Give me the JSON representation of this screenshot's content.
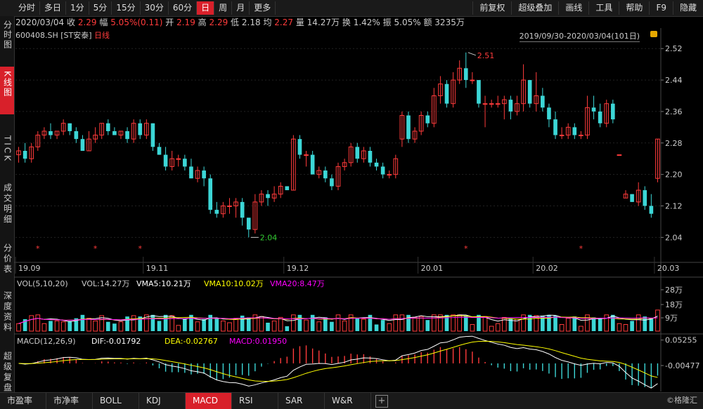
{
  "toolbar": {
    "periods": [
      "分时",
      "多日",
      "1分",
      "5分",
      "15分",
      "30分",
      "60分",
      "日",
      "周",
      "月",
      "更多"
    ],
    "active_period": "日",
    "right": [
      "前复权",
      "超级叠加",
      "画线",
      "工具",
      "帮助",
      "F9",
      "隐藏"
    ]
  },
  "sidebar": {
    "items": [
      "分时图",
      "K线图",
      "TICK",
      "成交明细",
      "分价表",
      "深度资料",
      "超级复盘"
    ],
    "active": "K线图"
  },
  "quote": {
    "date": "2020/03/04",
    "close_label": "收",
    "close": "2.29",
    "change_label": "幅",
    "change": "5.05%(0.11)",
    "open_label": "开",
    "open": "2.19",
    "high_label": "高",
    "high": "2.29",
    "low_label": "低",
    "low": "2.18",
    "avg_label": "均",
    "avg": "2.27",
    "volume_label": "量",
    "volume": "14.27万",
    "turnover_label": "换",
    "turnover": "1.42%",
    "amplitude_label": "振",
    "amplitude": "5.05%",
    "amount_label": "额",
    "amount": "3235万"
  },
  "symbol": "600408.SH",
  "name": "[ST安泰]",
  "line_type": "日线",
  "date_range": "2019/09/30-2020/03/04(101日)",
  "vol_legend": {
    "name": "VOL(5,10,20)",
    "vol": "VOL:14.27万",
    "vma5": "VMA5:10.21万",
    "vma10": "VMA10:10.02万",
    "vma20": "VMA20:8.47万"
  },
  "macd_legend": {
    "name": "MACD(12,26,9)",
    "dif": "DIF:-0.01792",
    "dea": "DEA:-0.02767",
    "macd": "MACD:0.01950"
  },
  "bottom_tabs": [
    "市盈率",
    "市净率",
    "BOLL",
    "KDJ",
    "MACD",
    "RSI",
    "SAR",
    "W&R"
  ],
  "active_bottom_tab": "MACD",
  "watermark": "©格隆汇",
  "colors": {
    "up": "#ff3b3b",
    "down": "#3cd6d6",
    "ma5": "#ffffff",
    "ma10": "#ffff00",
    "ma20": "#ff00ff",
    "accent": "#d8202a"
  },
  "chart_data": [
    {
      "type": "candlestick",
      "title": "600408.SH [ST安泰] 日线",
      "x_ticks": [
        "19.09",
        "19.11",
        "19.12",
        "20.01",
        "20.02",
        "20.03"
      ],
      "y_ticks": [
        2.52,
        2.44,
        2.36,
        2.28,
        2.2,
        2.12,
        2.04
      ],
      "ylim": [
        1.98,
        2.54
      ],
      "annotations": [
        {
          "label": "2.51",
          "value": 2.51
        },
        {
          "label": "2.04",
          "value": 2.04
        }
      ],
      "markers": "*",
      "candles": [
        [
          2.25,
          2.26,
          2.23,
          2.27
        ],
        [
          2.26,
          2.24,
          2.23,
          2.28
        ],
        [
          2.24,
          2.27,
          2.23,
          2.28
        ],
        [
          2.27,
          2.3,
          2.26,
          2.31
        ],
        [
          2.3,
          2.31,
          2.29,
          2.32
        ],
        [
          2.31,
          2.3,
          2.29,
          2.33
        ],
        [
          2.3,
          2.31,
          2.29,
          2.31
        ],
        [
          2.31,
          2.33,
          2.3,
          2.34
        ],
        [
          2.33,
          2.31,
          2.3,
          2.33
        ],
        [
          2.31,
          2.29,
          2.28,
          2.32
        ],
        [
          2.29,
          2.26,
          2.26,
          2.3
        ],
        [
          2.26,
          2.29,
          2.26,
          2.31
        ],
        [
          2.29,
          2.3,
          2.28,
          2.32
        ],
        [
          2.3,
          2.33,
          2.29,
          2.33
        ],
        [
          2.33,
          2.31,
          2.3,
          2.34
        ],
        [
          2.31,
          2.3,
          2.3,
          2.32
        ],
        [
          2.3,
          2.31,
          2.29,
          2.31
        ],
        [
          2.31,
          2.29,
          2.28,
          2.32
        ],
        [
          2.29,
          2.33,
          2.28,
          2.34
        ],
        [
          2.33,
          2.3,
          2.29,
          2.34
        ],
        [
          2.3,
          2.33,
          2.29,
          2.34
        ],
        [
          2.33,
          2.27,
          2.26,
          2.33
        ],
        [
          2.27,
          2.25,
          2.25,
          2.28
        ],
        [
          2.25,
          2.22,
          2.21,
          2.27
        ],
        [
          2.22,
          2.24,
          2.21,
          2.26
        ],
        [
          2.24,
          2.24,
          2.22,
          2.25
        ],
        [
          2.24,
          2.22,
          2.21,
          2.25
        ],
        [
          2.22,
          2.19,
          2.19,
          2.24
        ],
        [
          2.19,
          2.21,
          2.18,
          2.22
        ],
        [
          2.21,
          2.19,
          2.17,
          2.22
        ],
        [
          2.19,
          2.11,
          2.1,
          2.2
        ],
        [
          2.11,
          2.1,
          2.09,
          2.13
        ],
        [
          2.1,
          2.12,
          2.09,
          2.13
        ],
        [
          2.12,
          2.12,
          2.1,
          2.14
        ],
        [
          2.12,
          2.13,
          2.09,
          2.14
        ],
        [
          2.13,
          2.09,
          2.07,
          2.14
        ],
        [
          2.09,
          2.06,
          2.04,
          2.09
        ],
        [
          2.06,
          2.13,
          2.05,
          2.15
        ],
        [
          2.13,
          2.15,
          2.12,
          2.16
        ],
        [
          2.15,
          2.14,
          2.12,
          2.16
        ],
        [
          2.14,
          2.15,
          2.13,
          2.17
        ],
        [
          2.15,
          2.17,
          2.14,
          2.18
        ],
        [
          2.17,
          2.16,
          2.16,
          2.17
        ],
        [
          2.16,
          2.29,
          2.16,
          2.3
        ],
        [
          2.29,
          2.25,
          2.24,
          2.3
        ],
        [
          2.25,
          2.25,
          2.22,
          2.26
        ],
        [
          2.25,
          2.2,
          2.2,
          2.26
        ],
        [
          2.2,
          2.21,
          2.19,
          2.22
        ],
        [
          2.21,
          2.19,
          2.18,
          2.22
        ],
        [
          2.19,
          2.17,
          2.16,
          2.2
        ],
        [
          2.17,
          2.22,
          2.16,
          2.23
        ],
        [
          2.22,
          2.23,
          2.21,
          2.24
        ],
        [
          2.23,
          2.27,
          2.22,
          2.28
        ],
        [
          2.27,
          2.24,
          2.23,
          2.28
        ],
        [
          2.24,
          2.26,
          2.23,
          2.27
        ],
        [
          2.26,
          2.23,
          2.22,
          2.27
        ],
        [
          2.23,
          2.22,
          2.21,
          2.24
        ],
        [
          2.22,
          2.2,
          2.19,
          2.23
        ],
        [
          2.2,
          2.2,
          2.19,
          2.21
        ],
        [
          2.2,
          2.24,
          2.19,
          2.25
        ],
        [
          2.29,
          2.35,
          2.27,
          2.36
        ],
        [
          2.35,
          2.29,
          2.28,
          2.36
        ],
        [
          2.29,
          2.31,
          2.28,
          2.32
        ],
        [
          2.31,
          2.35,
          2.3,
          2.36
        ],
        [
          2.35,
          2.33,
          2.32,
          2.36
        ],
        [
          2.33,
          2.4,
          2.32,
          2.42
        ],
        [
          2.4,
          2.43,
          2.38,
          2.45
        ],
        [
          2.43,
          2.38,
          2.37,
          2.44
        ],
        [
          2.38,
          2.44,
          2.37,
          2.46
        ],
        [
          2.44,
          2.47,
          2.43,
          2.49
        ],
        [
          2.47,
          2.44,
          2.42,
          2.51
        ],
        [
          2.44,
          2.44,
          2.43,
          2.46
        ],
        [
          2.44,
          2.38,
          2.37,
          2.43
        ],
        [
          2.38,
          2.38,
          2.32,
          2.4
        ],
        [
          2.38,
          2.38,
          2.37,
          2.39
        ],
        [
          2.38,
          2.38,
          2.37,
          2.4
        ],
        [
          2.38,
          2.39,
          2.34,
          2.4
        ],
        [
          2.39,
          2.36,
          2.34,
          2.4
        ],
        [
          2.36,
          2.38,
          2.35,
          2.4
        ],
        [
          2.38,
          2.44,
          2.36,
          2.48
        ],
        [
          2.44,
          2.38,
          2.37,
          2.44
        ],
        [
          2.38,
          2.4,
          2.36,
          2.46
        ],
        [
          2.4,
          2.37,
          2.36,
          2.42
        ],
        [
          2.37,
          2.34,
          2.32,
          2.38
        ],
        [
          2.34,
          2.3,
          2.29,
          2.36
        ],
        [
          2.3,
          2.3,
          2.29,
          2.32
        ],
        [
          2.3,
          2.32,
          2.29,
          2.33
        ],
        [
          2.32,
          2.3,
          2.29,
          2.33
        ],
        [
          2.3,
          2.3,
          2.29,
          2.31
        ],
        [
          2.3,
          2.37,
          2.29,
          2.4
        ],
        [
          2.37,
          2.36,
          2.34,
          2.4
        ],
        [
          2.36,
          2.33,
          2.32,
          2.38
        ],
        [
          2.33,
          2.38,
          2.32,
          2.39
        ],
        [
          2.38,
          2.34,
          2.33,
          2.39
        ],
        [
          2.25,
          2.25,
          2.25,
          2.25
        ],
        [
          2.14,
          2.15,
          2.14,
          2.16
        ],
        [
          2.15,
          2.13,
          2.13,
          2.15
        ],
        [
          2.13,
          2.16,
          2.12,
          2.18
        ],
        [
          2.16,
          2.12,
          2.11,
          2.17
        ],
        [
          2.12,
          2.1,
          2.09,
          2.15
        ],
        [
          2.19,
          2.29,
          2.18,
          2.29
        ]
      ]
    },
    {
      "type": "bar",
      "title": "VOL(5,10,20)",
      "y_ticks": [
        "28万",
        "18万",
        "9万"
      ],
      "ylim": [
        0,
        28
      ],
      "unit": "万",
      "last_value": 14.27,
      "ma": {
        "VMA5": 10.21,
        "VMA10": 10.02,
        "VMA20": 8.47
      }
    },
    {
      "type": "bar",
      "title": "MACD(12,26,9)",
      "y_ticks": [
        "0.05255",
        "-0.00477"
      ],
      "ylim": [
        -0.06,
        0.06
      ],
      "dif": -0.01792,
      "dea": -0.02767,
      "macd": 0.0195
    }
  ]
}
